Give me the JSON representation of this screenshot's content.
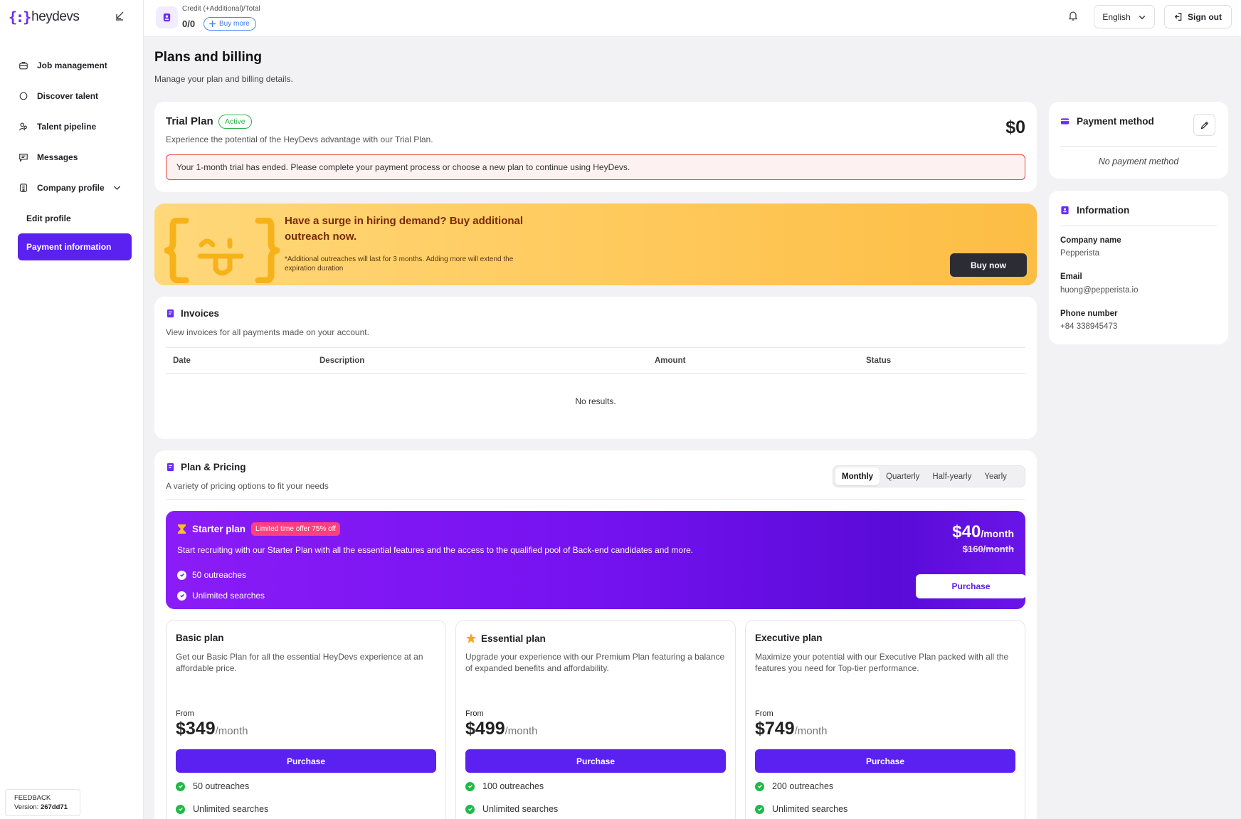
{
  "app": {
    "brand_mark": "{:}",
    "brand_name": "heydevs"
  },
  "sidebar": {
    "items": [
      {
        "label": "Job management",
        "icon": "briefcase-icon"
      },
      {
        "label": "Discover talent",
        "icon": "search-icon"
      },
      {
        "label": "Talent pipeline",
        "icon": "people-icon"
      },
      {
        "label": "Messages",
        "icon": "chat-icon"
      },
      {
        "label": "Company profile",
        "icon": "building-icon"
      }
    ],
    "sub_items": [
      {
        "label": "Edit profile"
      },
      {
        "label": "Payment information",
        "active": true
      }
    ],
    "feedback": {
      "label": "FEEDBACK",
      "version_label": "Version:",
      "version": "267dd71"
    }
  },
  "topbar": {
    "credit_label": "Credit (+Additional)/Total",
    "credit_value": "0/0",
    "buy_more": "Buy more",
    "language": "English",
    "sign_out": "Sign out"
  },
  "page": {
    "title": "Plans and billing",
    "subtitle": "Manage your plan and billing details."
  },
  "trial": {
    "name": "Trial Plan",
    "status": "Active",
    "description": "Experience the potential of the HeyDevs advantage with our Trial Plan.",
    "price": "$0",
    "alert": "Your 1-month trial has ended. Please complete your payment process or choose a new plan to continue using HeyDevs."
  },
  "promo": {
    "title": "Have a surge in hiring demand? Buy additional outreach now.",
    "note": "*Additional outreaches will last for 3 months. Adding more will extend the expiration duration",
    "button": "Buy now"
  },
  "invoices": {
    "title": "Invoices",
    "subtitle": "View invoices for all payments made on your account.",
    "columns": [
      "Date",
      "Description",
      "Amount",
      "Status"
    ],
    "empty": "No results."
  },
  "pricing": {
    "title": "Plan & Pricing",
    "subtitle": "A variety of pricing options to fit your needs",
    "periods": [
      "Monthly",
      "Quarterly",
      "Half-yearly",
      "Yearly"
    ],
    "active_period": "Monthly",
    "starter": {
      "name": "Starter plan",
      "badge": "Limited time offer 75% off",
      "description": "Start recruiting with our Starter Plan with all the essential features and the access to the qualified pool of Back-end candidates and more.",
      "features": [
        "50 outreaches",
        "Unlimited searches"
      ],
      "price": "$40",
      "per": "/month",
      "old_price": "$160/month",
      "button": "Purchase"
    },
    "plans": [
      {
        "name": "Basic plan",
        "description": "Get our Basic Plan for all the essential HeyDevs experience at an affordable price.",
        "from": "From",
        "price": "$349",
        "per": "/month",
        "button": "Purchase",
        "features": [
          "50 outreaches",
          "Unlimited searches"
        ]
      },
      {
        "name": "Essential plan",
        "description": "Upgrade your experience with our Premium Plan featuring a balance of expanded benefits and affordability.",
        "from": "From",
        "price": "$499",
        "per": "/month",
        "button": "Purchase",
        "features": [
          "100 outreaches",
          "Unlimited searches"
        ]
      },
      {
        "name": "Executive plan",
        "description": "Maximize your potential with our Executive Plan packed with all the features you need for Top-tier performance.",
        "from": "From",
        "price": "$749",
        "per": "/month",
        "button": "Purchase",
        "features": [
          "200 outreaches",
          "Unlimited searches"
        ]
      }
    ]
  },
  "payment_method": {
    "title": "Payment method",
    "empty": "No payment method"
  },
  "information": {
    "title": "Information",
    "fields": [
      {
        "label": "Company name",
        "value": "Pepperista"
      },
      {
        "label": "Email",
        "value": "huong@pepperista.io"
      },
      {
        "label": "Phone number",
        "value": "+84 338945473"
      }
    ]
  },
  "colors": {
    "accent": "#5b21f0",
    "success": "#21b84a",
    "danger": "#e04848",
    "promo_text": "#7a2a06"
  }
}
